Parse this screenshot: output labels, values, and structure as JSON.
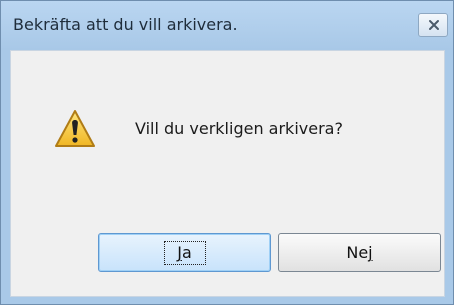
{
  "dialog": {
    "title": "Bekräfta att du vill arkivera.",
    "message": "Vill du verkligen arkivera?",
    "close_icon": "close-icon",
    "warning_icon": "warning-icon"
  },
  "buttons": {
    "yes": {
      "label_mnemonic": "J",
      "label_rest": "a"
    },
    "no": {
      "label_prefix": "Ne",
      "label_mnemonic": "j"
    }
  },
  "colors": {
    "titlebar": "#a9c9e8",
    "client": "#f0f0f0",
    "accent_button": "#c8e3fb",
    "warning": "#f2c230"
  }
}
